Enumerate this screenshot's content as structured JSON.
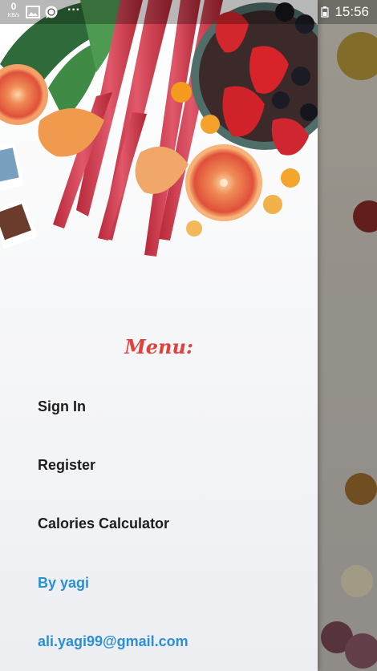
{
  "status_bar": {
    "net_speed_value": "0",
    "net_speed_unit": "KB/s",
    "more_glyph": "···",
    "time": "15:56"
  },
  "drawer": {
    "menu_title": "Menu:",
    "items": [
      {
        "label": "Sign In"
      },
      {
        "label": "Register"
      },
      {
        "label": "Calories Calculator"
      }
    ],
    "author": "By yagi",
    "email": "ali.yagi99@gmail.com"
  },
  "colors": {
    "menu_title": "#e0413a",
    "link": "#2b8fd6",
    "item_text": "#1d1d1d"
  }
}
